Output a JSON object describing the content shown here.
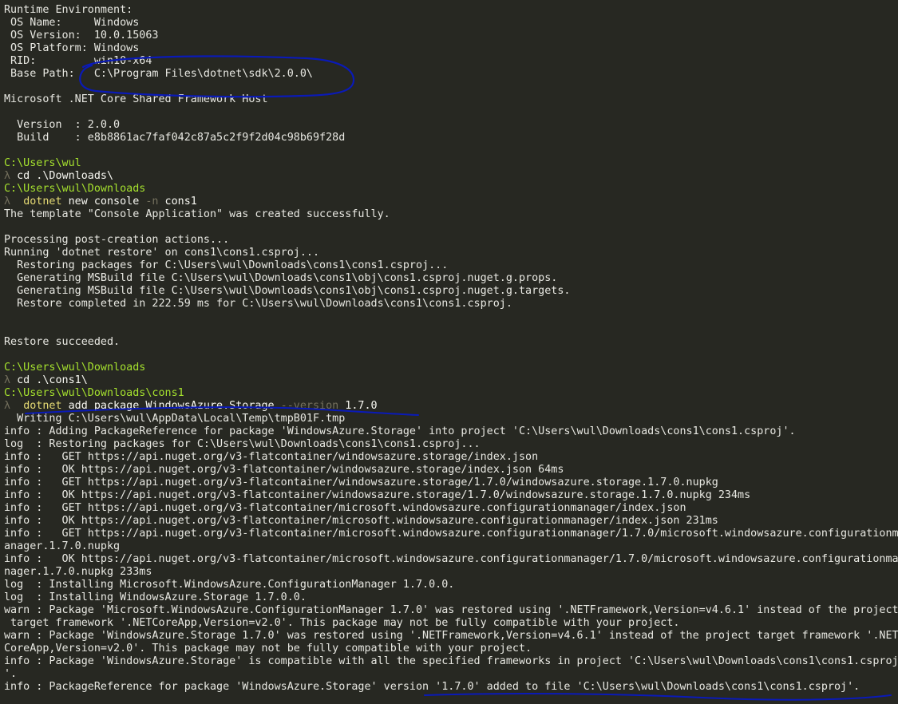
{
  "terminal": {
    "lines": [
      {
        "type": "text",
        "text": "Runtime Environment:"
      },
      {
        "type": "text",
        "text": " OS Name:     Windows"
      },
      {
        "type": "text",
        "text": " OS Version:  10.0.15063"
      },
      {
        "type": "text",
        "text": " OS Platform: Windows"
      },
      {
        "type": "text",
        "text": " RID:         win10-x64"
      },
      {
        "type": "text",
        "text": " Base Path:   C:\\Program Files\\dotnet\\sdk\\2.0.0\\"
      },
      {
        "type": "text",
        "text": ""
      },
      {
        "type": "text",
        "text": "Microsoft .NET Core Shared Framework Host"
      },
      {
        "type": "text",
        "text": ""
      },
      {
        "type": "text",
        "text": "  Version  : 2.0.0"
      },
      {
        "type": "text",
        "text": "  Build    : e8b8861ac7faf042c87a5c2f9f2d04c98b69f28d"
      },
      {
        "type": "text",
        "text": ""
      },
      {
        "type": "path",
        "text": "C:\\Users\\wul"
      },
      {
        "type": "prompt",
        "prompt": "λ",
        "cmd": " cd .\\Downloads\\"
      },
      {
        "type": "path",
        "text": "C:\\Users\\wul\\Downloads"
      },
      {
        "type": "dotnet",
        "prompt": "λ",
        "exe": "dotnet",
        "pre": " new console ",
        "opt": "-n",
        "post": " cons1"
      },
      {
        "type": "text",
        "text": "The template \"Console Application\" was created successfully."
      },
      {
        "type": "text",
        "text": ""
      },
      {
        "type": "text",
        "text": "Processing post-creation actions..."
      },
      {
        "type": "text",
        "text": "Running 'dotnet restore' on cons1\\cons1.csproj..."
      },
      {
        "type": "text",
        "text": "  Restoring packages for C:\\Users\\wul\\Downloads\\cons1\\cons1.csproj..."
      },
      {
        "type": "text",
        "text": "  Generating MSBuild file C:\\Users\\wul\\Downloads\\cons1\\obj\\cons1.csproj.nuget.g.props."
      },
      {
        "type": "text",
        "text": "  Generating MSBuild file C:\\Users\\wul\\Downloads\\cons1\\obj\\cons1.csproj.nuget.g.targets."
      },
      {
        "type": "text",
        "text": "  Restore completed in 222.59 ms for C:\\Users\\wul\\Downloads\\cons1\\cons1.csproj."
      },
      {
        "type": "text",
        "text": ""
      },
      {
        "type": "text",
        "text": ""
      },
      {
        "type": "text",
        "text": "Restore succeeded."
      },
      {
        "type": "text",
        "text": ""
      },
      {
        "type": "path",
        "text": "C:\\Users\\wul\\Downloads"
      },
      {
        "type": "prompt",
        "prompt": "λ",
        "cmd": " cd .\\cons1\\"
      },
      {
        "type": "path",
        "text": "C:\\Users\\wul\\Downloads\\cons1"
      },
      {
        "type": "dotnet",
        "prompt": "λ",
        "exe": "dotnet",
        "pre": " add package WindowsAzure.Storage ",
        "opt": "--version",
        "post": " 1.7.0"
      },
      {
        "type": "text",
        "text": "  Writing C:\\Users\\wul\\AppData\\Local\\Temp\\tmpB01F.tmp"
      },
      {
        "type": "text",
        "text": "info : Adding PackageReference for package 'WindowsAzure.Storage' into project 'C:\\Users\\wul\\Downloads\\cons1\\cons1.csproj'."
      },
      {
        "type": "text",
        "text": "log  : Restoring packages for C:\\Users\\wul\\Downloads\\cons1\\cons1.csproj..."
      },
      {
        "type": "text",
        "text": "info :   GET https://api.nuget.org/v3-flatcontainer/windowsazure.storage/index.json"
      },
      {
        "type": "text",
        "text": "info :   OK https://api.nuget.org/v3-flatcontainer/windowsazure.storage/index.json 64ms"
      },
      {
        "type": "text",
        "text": "info :   GET https://api.nuget.org/v3-flatcontainer/windowsazure.storage/1.7.0/windowsazure.storage.1.7.0.nupkg"
      },
      {
        "type": "text",
        "text": "info :   OK https://api.nuget.org/v3-flatcontainer/windowsazure.storage/1.7.0/windowsazure.storage.1.7.0.nupkg 234ms"
      },
      {
        "type": "text",
        "text": "info :   GET https://api.nuget.org/v3-flatcontainer/microsoft.windowsazure.configurationmanager/index.json"
      },
      {
        "type": "text",
        "text": "info :   OK https://api.nuget.org/v3-flatcontainer/microsoft.windowsazure.configurationmanager/index.json 231ms"
      },
      {
        "type": "text",
        "text": "info :   GET https://api.nuget.org/v3-flatcontainer/microsoft.windowsazure.configurationmanager/1.7.0/microsoft.windowsazure.configurationm"
      },
      {
        "type": "text",
        "text": "anager.1.7.0.nupkg"
      },
      {
        "type": "text",
        "text": "info :   OK https://api.nuget.org/v3-flatcontainer/microsoft.windowsazure.configurationmanager/1.7.0/microsoft.windowsazure.configurationma"
      },
      {
        "type": "text",
        "text": "nager.1.7.0.nupkg 233ms"
      },
      {
        "type": "text",
        "text": "log  : Installing Microsoft.WindowsAzure.ConfigurationManager 1.7.0.0."
      },
      {
        "type": "text",
        "text": "log  : Installing WindowsAzure.Storage 1.7.0.0."
      },
      {
        "type": "text",
        "text": "warn : Package 'Microsoft.WindowsAzure.ConfigurationManager 1.7.0' was restored using '.NETFramework,Version=v4.6.1' instead of the project"
      },
      {
        "type": "text",
        "text": " target framework '.NETCoreApp,Version=v2.0'. This package may not be fully compatible with your project."
      },
      {
        "type": "text",
        "text": "warn : Package 'WindowsAzure.Storage 1.7.0' was restored using '.NETFramework,Version=v4.6.1' instead of the project target framework '.NET"
      },
      {
        "type": "text",
        "text": "CoreApp,Version=v2.0'. This package may not be fully compatible with your project."
      },
      {
        "type": "text",
        "text": "info : Package 'WindowsAzure.Storage' is compatible with all the specified frameworks in project 'C:\\Users\\wul\\Downloads\\cons1\\cons1.csproj"
      },
      {
        "type": "text",
        "text": "'."
      },
      {
        "type": "text",
        "text": "info : PackageReference for package 'WindowsAzure.Storage' version '1.7.0' added to file 'C:\\Users\\wul\\Downloads\\cons1\\cons1.csproj'."
      }
    ]
  },
  "colors": {
    "background": "#272822",
    "text": "#e8e8e2",
    "path": "#a6e22e",
    "prompt": "#75715e",
    "dotnet": "#e6db74",
    "annotation": "#0a1ab8"
  }
}
